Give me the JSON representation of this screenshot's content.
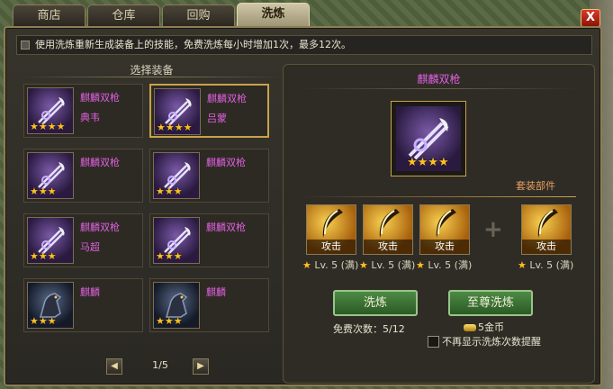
{
  "tabs": [
    {
      "label": "商店"
    },
    {
      "label": "仓库"
    },
    {
      "label": "回购"
    },
    {
      "label": "洗炼",
      "active": true
    }
  ],
  "close_label": "X",
  "tip": "使用洗炼重新生成装备上的技能，免费洗炼每小时增加1次，最多12次。",
  "left": {
    "title": "选择装备",
    "cards": [
      {
        "name": "麒麟双枪",
        "hero": "典韦",
        "stars": "★★★★",
        "type": "weapon"
      },
      {
        "name": "麒麟双枪",
        "hero": "吕蒙",
        "stars": "★★★★",
        "type": "weapon",
        "selected": true
      },
      {
        "name": "麒麟双枪",
        "hero": "",
        "stars": "★★★",
        "type": "weapon"
      },
      {
        "name": "麒麟双枪",
        "hero": "",
        "stars": "★★★",
        "type": "weapon"
      },
      {
        "name": "麒麟双枪",
        "hero": "马超",
        "stars": "★★★",
        "type": "weapon"
      },
      {
        "name": "麒麟双枪",
        "hero": "",
        "stars": "★★★",
        "type": "weapon"
      },
      {
        "name": "麒麟",
        "hero": "",
        "stars": "★★★",
        "type": "horse"
      },
      {
        "name": "麒麟",
        "hero": "",
        "stars": "★★★",
        "type": "horse"
      }
    ],
    "page": "1/5",
    "prev": "◀",
    "next": "▶"
  },
  "right": {
    "title": "麒麟双枪",
    "stars": "★★★★",
    "set_label": "套装部件",
    "parts": [
      {
        "label": "攻击",
        "level": "Lv. 5 (满)"
      },
      {
        "label": "攻击",
        "level": "Lv. 5 (满)"
      },
      {
        "label": "攻击",
        "level": "Lv. 5 (满)"
      },
      {
        "label": "攻击",
        "level": "Lv. 5 (满)"
      }
    ],
    "plus": "+",
    "wash_button": "洗炼",
    "premium_button": "至尊洗炼",
    "free_count": "免费次数：5/12",
    "cost": "5金币",
    "no_remind": "不再显示洗炼次数提醒"
  },
  "colors": {
    "epic": "#e060e0",
    "star": "#ffc020",
    "button": "#4e8a46"
  }
}
